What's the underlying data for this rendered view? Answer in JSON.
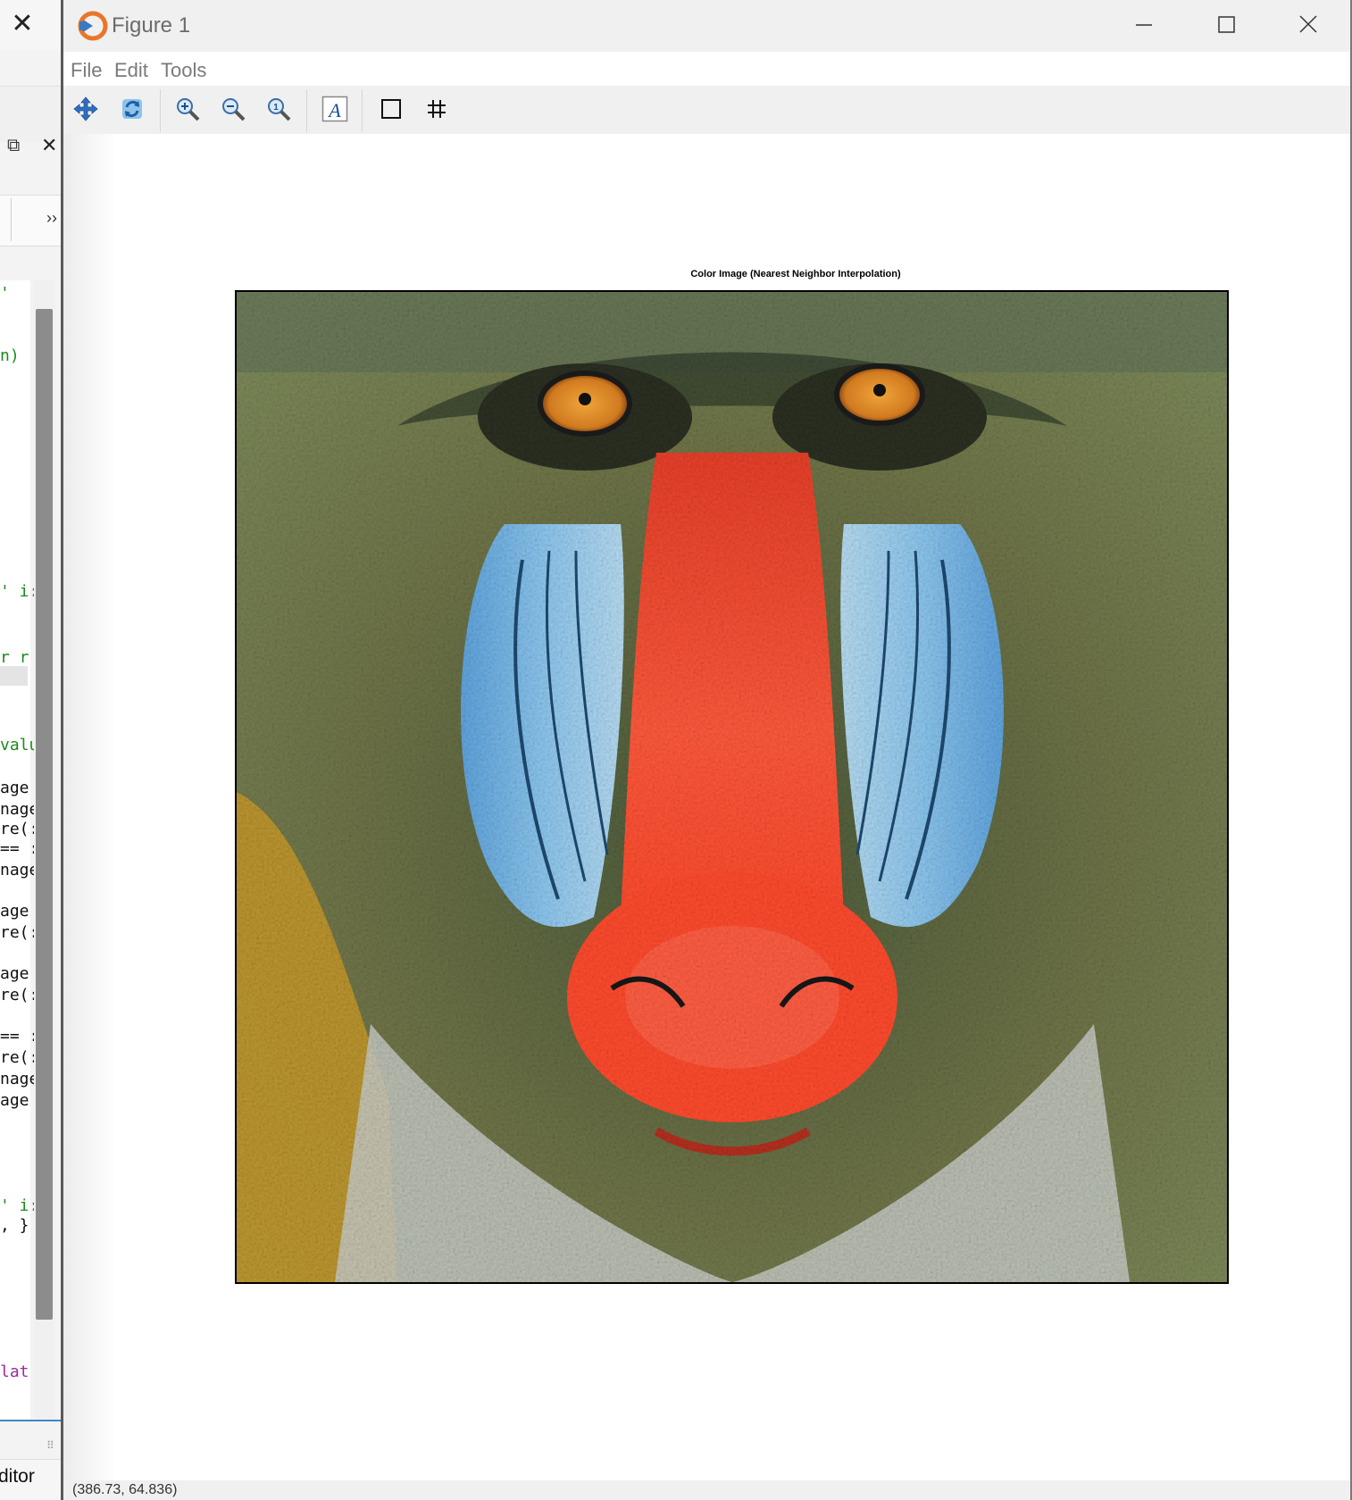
{
  "window": {
    "title": "Figure 1",
    "menu": [
      "File",
      "Edit",
      "Tools"
    ]
  },
  "toolbar": {
    "buttons": [
      "pan",
      "rotate",
      "zoom-in",
      "zoom-out",
      "zoom-reset",
      "text-annotation",
      "toggle-axes-box",
      "toggle-grid"
    ]
  },
  "plot": {
    "title": "Color Image (Nearest Neighbor Interpolation)",
    "image_subject": "mandrill",
    "colors": {
      "fur": "#6f7448",
      "cheek_blue": "#74b3e6",
      "nose_red": "#ff4b2e",
      "eye_orange": "#d98a28"
    }
  },
  "status": {
    "coordinates": "(386.73, 64.836)"
  },
  "editor": {
    "status_label": "ditor",
    "code_fragments": [
      {
        "text": "'",
        "color": "#1a8c1a"
      },
      {
        "text": "n)",
        "color": "#1a8c1a"
      },
      {
        "text": "' i:",
        "color": "#1a8c1a"
      },
      {
        "text": "r r",
        "color": "#1a8c1a"
      },
      {
        "text": "valu",
        "color": "#1a8c1a"
      },
      {
        "text": "age",
        "color": "#111111"
      },
      {
        "text": "nage",
        "color": "#111111"
      },
      {
        "text": "re(:",
        "color": "#111111"
      },
      {
        "text": "== :",
        "color": "#111111"
      },
      {
        "text": "nage",
        "color": "#111111"
      },
      {
        "text": "age",
        "color": "#111111"
      },
      {
        "text": "re(:",
        "color": "#111111"
      },
      {
        "text": "age",
        "color": "#111111"
      },
      {
        "text": "re(:",
        "color": "#111111"
      },
      {
        "text": "== :",
        "color": "#111111"
      },
      {
        "text": "re(:",
        "color": "#111111"
      },
      {
        "text": "nage",
        "color": "#111111"
      },
      {
        "text": "age",
        "color": "#111111"
      },
      {
        "text": "' i:",
        "color": "#1a8c1a"
      },
      {
        "text": ", }",
        "color": "#111111"
      },
      {
        "text": "lat",
        "color": "#9b2aa6"
      }
    ]
  }
}
